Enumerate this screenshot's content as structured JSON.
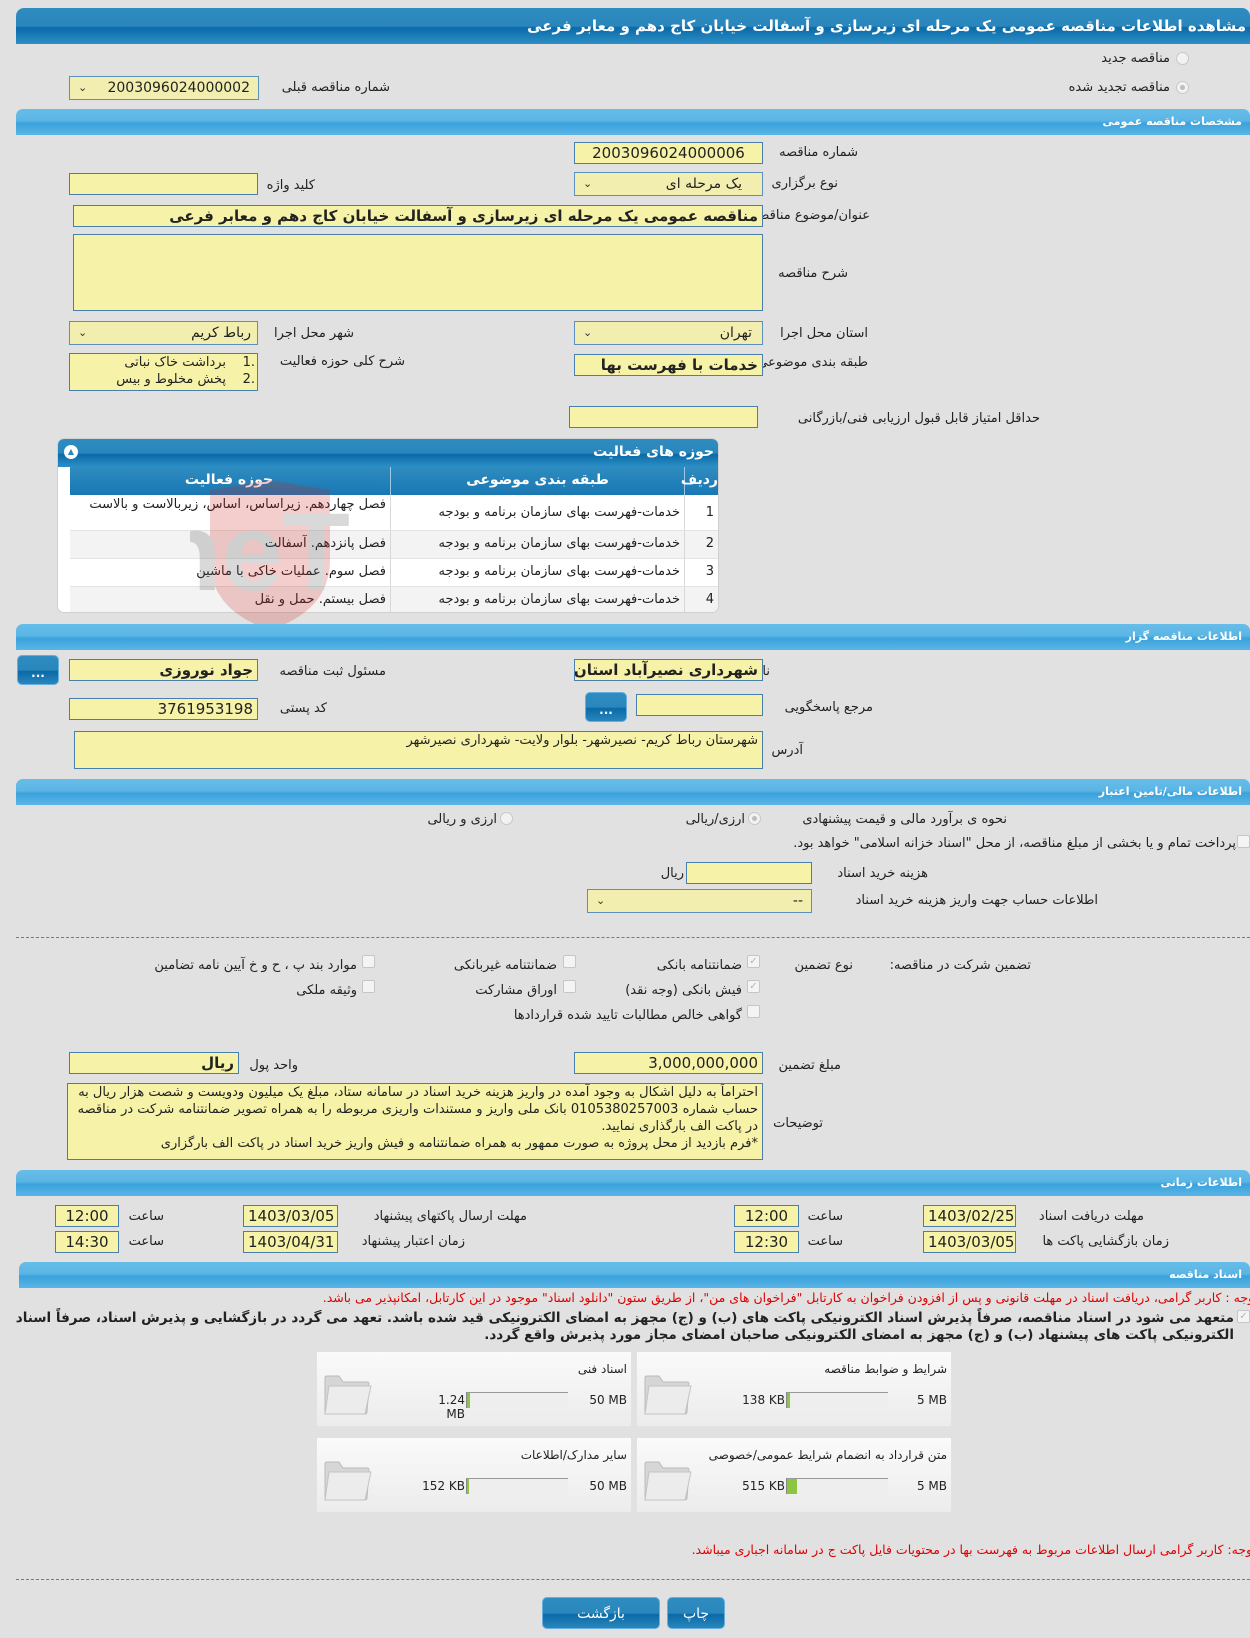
{
  "page_title": "مشاهده اطلاعات مناقصه عمومی یک مرحله ای زیرسازی و آسفالت خیابان کاج دهم و معابر فرعی",
  "tender_type": {
    "new_label": "مناقصه جدید",
    "renewed_label": "مناقصه تجدید شده",
    "selected": "renewed",
    "previous_number_label": "شماره مناقصه قبلی",
    "previous_number": "2003096024000002"
  },
  "general": {
    "section_title": "مشخصات مناقصه عمومی",
    "number_label": "شماره مناقصه",
    "number": "2003096024000006",
    "type_label": "نوع برگزاری",
    "type_value": "یک مرحله ای",
    "keyword_label": "کلید واژه",
    "keyword": "",
    "subject_label": "عنوان/موضوع مناقصه",
    "subject": "مناقصه عمومی یک مرحله ای زیرسازی و آسفالت خیابان کاج دهم و معابر فرعی",
    "description_label": "شرح مناقصه",
    "description": "",
    "province_label": "استان محل اجرا",
    "province": "تهران",
    "city_label": "شهر محل اجرا",
    "city": "رباط کریم",
    "category_label": "طبقه بندی موضوعی",
    "category": "خدمات با فهرست بها",
    "activity_desc_label": "شرح کلی حوزه فعالیت",
    "activity_desc_items": [
      "برداشت خاک نباتی",
      "پخش مخلوط و بیس"
    ],
    "min_score_label": "حداقل امتیاز قابل قبول ارزیابی فنی/بازرگانی",
    "min_score": ""
  },
  "activity_table": {
    "title": "حوزه های فعالیت",
    "columns": [
      "ردیف",
      "طبقه بندی موضوعی",
      "حوزه فعالیت"
    ],
    "rows": [
      {
        "num": "1",
        "category": "خدمات-فهرست بهای سازمان برنامه و بودجه",
        "activity": "فصل چهاردهم. زیراساس، اساس، زیربالاست  و بالاست"
      },
      {
        "num": "2",
        "category": "خدمات-فهرست بهای سازمان برنامه و بودجه",
        "activity": "فصل پانزدهم. آسفالت"
      },
      {
        "num": "3",
        "category": "خدمات-فهرست بهای سازمان برنامه و بودجه",
        "activity": "فصل سوم. عملیات خاکی با ماشین"
      },
      {
        "num": "4",
        "category": "خدمات-فهرست بهای سازمان برنامه و بودجه",
        "activity": "فصل بیستم. حمل و نقل"
      }
    ]
  },
  "organizer": {
    "section_title": "اطلاعات مناقصه گزار",
    "org_label": "نام دستگاه اجرایی مناقصه گزار",
    "org": "شهرداری نصیرآباد استان تهران",
    "registrar_label": "مسئول ثبت مناقصه",
    "registrar": "جواد نوروزی",
    "reference_label": "مرجع پاسخگویی",
    "reference": "",
    "postal_label": "کد پستی",
    "postal": "3761953198",
    "address_label": "آدرس",
    "address": "شهرستان رباط کریم- نصیرشهر- بلوار ولایت- شهرداری نصیرشهر",
    "more_button": "..."
  },
  "finance": {
    "section_title": "اطلاعات مالی/تامین اعتبار",
    "estimate_label": "نحوه ی برآورد مالی و قیمت پیشنهادی",
    "option_rial": "ارزی/ریالی",
    "option_both": "ارزی و ریالی",
    "treasury_text": "پرداخت تمام و یا بخشی از مبلغ مناقصه، از محل \"اسناد خزانه اسلامی\" خواهد بود.",
    "doc_cost_label": "هزینه خرید اسناد",
    "doc_cost": "",
    "doc_cost_unit": "ریال",
    "account_label": "اطلاعات حساب جهت واریز هزینه خرید اسناد",
    "account_value": "--"
  },
  "guarantee": {
    "participation_label": "تضمین شرکت در مناقصه:",
    "type_label": "نوع تضمین",
    "options": [
      {
        "label": "ضمانتنامه بانکی",
        "checked": true
      },
      {
        "label": "ضمانتنامه غیربانکی",
        "checked": false
      },
      {
        "label": "موارد بند پ ، ح و خ آیین نامه تضامین",
        "checked": false
      },
      {
        "label": "فیش بانکی (وجه نقد)",
        "checked": true
      },
      {
        "label": "اوراق مشارکت",
        "checked": false
      },
      {
        "label": "وثیقه ملکی",
        "checked": false
      },
      {
        "label": "گواهی خالص مطالبات تایید شده قراردادها",
        "checked": false
      }
    ],
    "amount_label": "مبلغ تضمین",
    "amount": "3,000,000,000",
    "currency_label": "واحد پول",
    "currency": "ریال",
    "notes_label": "توضیحات",
    "notes": "احتراماً به دلیل اشکال به وجود آمده در واریز هزینه خرید اسناد در سامانه ستاد، مبلغ یک میلیون ودویست و شصت هزار ریال به حساب شماره 0105380257003 بانک ملی واریز و مستندات واریزی مربوطه را به همراه تصویر ضمانتنامه شرکت در مناقصه در پاکت الف بارگذاری نمایید.\n*فرم بازدید از محل پروژه به صورت ممهور به همراه ضمانتنامه و فیش واریز خرید اسناد در پاکت الف بارگزاری"
  },
  "timing": {
    "section_title": "اطلاعات زمانی",
    "doc_deadline_label": "مهلت دریافت اسناد",
    "doc_deadline_date": "1403/02/25",
    "doc_deadline_time": "12:00",
    "submit_deadline_label": "مهلت ارسال پاکتهای پیشنهاد",
    "submit_deadline_date": "1403/03/05",
    "submit_deadline_time": "12:00",
    "opening_label": "زمان بازگشایی پاکت ها",
    "opening_date": "1403/03/05",
    "opening_time": "12:30",
    "validity_label": "زمان اعتبار پیشنهاد",
    "validity_date": "1403/04/31",
    "validity_time": "14:30",
    "time_label": "ساعت"
  },
  "documents": {
    "section_title": "اسناد مناقصه",
    "notice": "توجه : کاربر گرامی، دریافت اسناد در مهلت قانونی و پس از افزودن فراخوان به کارتابل \"فراخوان های من\"، از طریق ستون \"دانلود اسناد\" موجود در این کارتابل، امکانپذیر می باشد.",
    "commitment": "متعهد می شود در اسناد مناقصه، صرفاً پذیرش اسناد الکترونیکی پاکت های (ب) و (ج) مجهز به امضای الکترونیکی قید شده باشد. تعهد می گردد در بازگشایی و پذیرش اسناد، صرفاً اسناد الکترونیکی پاکت های پیشنهاد (ب) و (ج) مجهز به امضای الکترونیکی صاحبان امضای مجاز مورد پذیرش واقع گردد.",
    "files": [
      {
        "name": "شرایط و ضوابط مناقصه",
        "size": "138 KB",
        "max": "5 MB",
        "fill": 0.027
      },
      {
        "name": "اسناد فنی",
        "size": "1.24 MB",
        "max": "50 MB",
        "fill": 0.025
      },
      {
        "name": "متن قرارداد به انضمام شرایط عمومی/خصوصی",
        "size": "515 KB",
        "max": "5 MB",
        "fill": 0.1
      },
      {
        "name": "سایر مدارک/اطلاعات",
        "size": "152 KB",
        "max": "50 MB",
        "fill": 0.003
      }
    ],
    "price_notice": "توجه: کاربر گرامی ارسال اطلاعات مربوط به فهرست بها در محتویات فایل پاکت ج در سامانه اجباری میباشد."
  },
  "actions": {
    "print": "چاپ",
    "back": "بازگشت"
  },
  "watermark": "AriaTender.neT"
}
